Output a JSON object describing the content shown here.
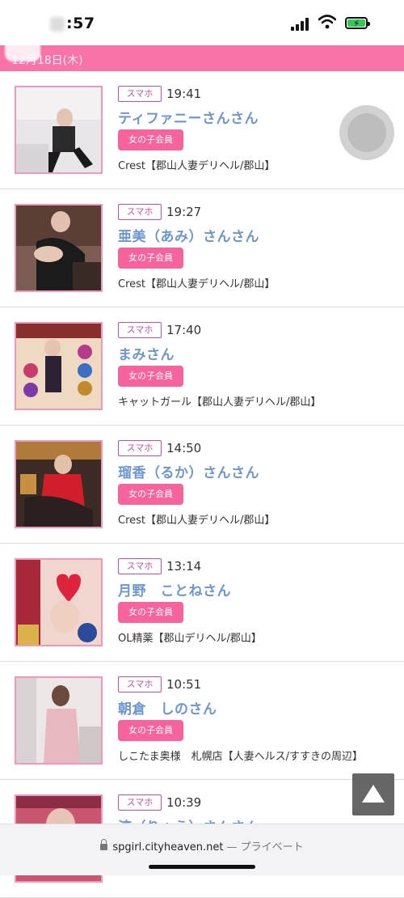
{
  "status_bar": {
    "time": ":57",
    "accent_battery": "#35c759"
  },
  "header": {
    "date": "12月18日(木)",
    "bar_color": "#f874a8"
  },
  "entries": [
    {
      "badge": "スマホ",
      "time": "19:41",
      "name": "ティファニーさんさん",
      "member_label": "女の子会員",
      "shop": "Crest【郡山人妻デリヘル/郡山】"
    },
    {
      "badge": "スマホ",
      "time": "19:27",
      "name": "亜美（あみ）さんさん",
      "member_label": "女の子会員",
      "shop": "Crest【郡山人妻デリヘル/郡山】"
    },
    {
      "badge": "スマホ",
      "time": "17:40",
      "name": "まみさん",
      "member_label": "女の子会員",
      "shop": "キャットガール【郡山人妻デリヘル/郡山】"
    },
    {
      "badge": "スマホ",
      "time": "14:50",
      "name": "瑠香（るか）さんさん",
      "member_label": "女の子会員",
      "shop": "Crest【郡山人妻デリヘル/郡山】"
    },
    {
      "badge": "スマホ",
      "time": "13:14",
      "name": "月野　ことねさん",
      "member_label": "女の子会員",
      "shop": "OL精薬【郡山デリヘル/郡山】"
    },
    {
      "badge": "スマホ",
      "time": "10:51",
      "name": "朝倉　しのさん",
      "member_label": "女の子会員",
      "shop": "しこたま奥様　札幌店【人妻ヘルス/すすきの周辺】"
    },
    {
      "badge": "スマホ",
      "time": "10:39",
      "name": "涼（りょう）さんさん",
      "member_label": "",
      "shop": ""
    }
  ],
  "controls": {
    "scroll_top_icon": "triangle-up-icon"
  },
  "browser": {
    "url": "spgirl.cityheaven.net",
    "mode": "— プライベート"
  }
}
